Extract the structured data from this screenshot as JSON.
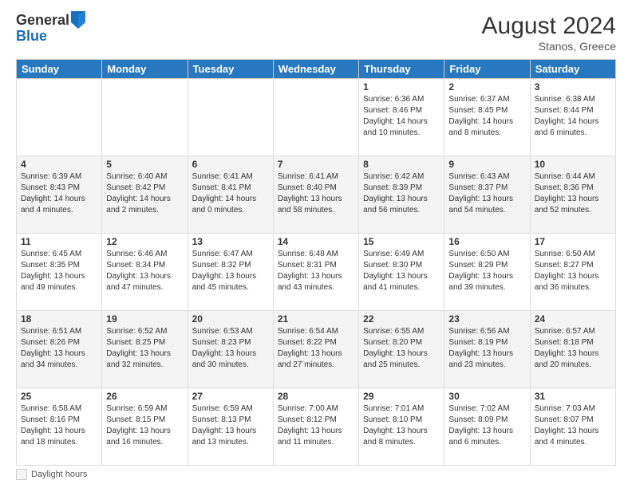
{
  "logo": {
    "general": "General",
    "blue": "Blue"
  },
  "title": "August 2024",
  "location": "Stanos, Greece",
  "legend": "Daylight hours",
  "days_of_week": [
    "Sunday",
    "Monday",
    "Tuesday",
    "Wednesday",
    "Thursday",
    "Friday",
    "Saturday"
  ],
  "weeks": [
    [
      {
        "day": "",
        "info": ""
      },
      {
        "day": "",
        "info": ""
      },
      {
        "day": "",
        "info": ""
      },
      {
        "day": "",
        "info": ""
      },
      {
        "day": "1",
        "info": "Sunrise: 6:36 AM\nSunset: 8:46 PM\nDaylight: 14 hours\nand 10 minutes."
      },
      {
        "day": "2",
        "info": "Sunrise: 6:37 AM\nSunset: 8:45 PM\nDaylight: 14 hours\nand 8 minutes."
      },
      {
        "day": "3",
        "info": "Sunrise: 6:38 AM\nSunset: 8:44 PM\nDaylight: 14 hours\nand 6 minutes."
      }
    ],
    [
      {
        "day": "4",
        "info": "Sunrise: 6:39 AM\nSunset: 8:43 PM\nDaylight: 14 hours\nand 4 minutes."
      },
      {
        "day": "5",
        "info": "Sunrise: 6:40 AM\nSunset: 8:42 PM\nDaylight: 14 hours\nand 2 minutes."
      },
      {
        "day": "6",
        "info": "Sunrise: 6:41 AM\nSunset: 8:41 PM\nDaylight: 14 hours\nand 0 minutes."
      },
      {
        "day": "7",
        "info": "Sunrise: 6:41 AM\nSunset: 8:40 PM\nDaylight: 13 hours\nand 58 minutes."
      },
      {
        "day": "8",
        "info": "Sunrise: 6:42 AM\nSunset: 8:39 PM\nDaylight: 13 hours\nand 56 minutes."
      },
      {
        "day": "9",
        "info": "Sunrise: 6:43 AM\nSunset: 8:37 PM\nDaylight: 13 hours\nand 54 minutes."
      },
      {
        "day": "10",
        "info": "Sunrise: 6:44 AM\nSunset: 8:36 PM\nDaylight: 13 hours\nand 52 minutes."
      }
    ],
    [
      {
        "day": "11",
        "info": "Sunrise: 6:45 AM\nSunset: 8:35 PM\nDaylight: 13 hours\nand 49 minutes."
      },
      {
        "day": "12",
        "info": "Sunrise: 6:46 AM\nSunset: 8:34 PM\nDaylight: 13 hours\nand 47 minutes."
      },
      {
        "day": "13",
        "info": "Sunrise: 6:47 AM\nSunset: 8:32 PM\nDaylight: 13 hours\nand 45 minutes."
      },
      {
        "day": "14",
        "info": "Sunrise: 6:48 AM\nSunset: 8:31 PM\nDaylight: 13 hours\nand 43 minutes."
      },
      {
        "day": "15",
        "info": "Sunrise: 6:49 AM\nSunset: 8:30 PM\nDaylight: 13 hours\nand 41 minutes."
      },
      {
        "day": "16",
        "info": "Sunrise: 6:50 AM\nSunset: 8:29 PM\nDaylight: 13 hours\nand 39 minutes."
      },
      {
        "day": "17",
        "info": "Sunrise: 6:50 AM\nSunset: 8:27 PM\nDaylight: 13 hours\nand 36 minutes."
      }
    ],
    [
      {
        "day": "18",
        "info": "Sunrise: 6:51 AM\nSunset: 8:26 PM\nDaylight: 13 hours\nand 34 minutes."
      },
      {
        "day": "19",
        "info": "Sunrise: 6:52 AM\nSunset: 8:25 PM\nDaylight: 13 hours\nand 32 minutes."
      },
      {
        "day": "20",
        "info": "Sunrise: 6:53 AM\nSunset: 8:23 PM\nDaylight: 13 hours\nand 30 minutes."
      },
      {
        "day": "21",
        "info": "Sunrise: 6:54 AM\nSunset: 8:22 PM\nDaylight: 13 hours\nand 27 minutes."
      },
      {
        "day": "22",
        "info": "Sunrise: 6:55 AM\nSunset: 8:20 PM\nDaylight: 13 hours\nand 25 minutes."
      },
      {
        "day": "23",
        "info": "Sunrise: 6:56 AM\nSunset: 8:19 PM\nDaylight: 13 hours\nand 23 minutes."
      },
      {
        "day": "24",
        "info": "Sunrise: 6:57 AM\nSunset: 8:18 PM\nDaylight: 13 hours\nand 20 minutes."
      }
    ],
    [
      {
        "day": "25",
        "info": "Sunrise: 6:58 AM\nSunset: 8:16 PM\nDaylight: 13 hours\nand 18 minutes."
      },
      {
        "day": "26",
        "info": "Sunrise: 6:59 AM\nSunset: 8:15 PM\nDaylight: 13 hours\nand 16 minutes."
      },
      {
        "day": "27",
        "info": "Sunrise: 6:59 AM\nSunset: 8:13 PM\nDaylight: 13 hours\nand 13 minutes."
      },
      {
        "day": "28",
        "info": "Sunrise: 7:00 AM\nSunset: 8:12 PM\nDaylight: 13 hours\nand 11 minutes."
      },
      {
        "day": "29",
        "info": "Sunrise: 7:01 AM\nSunset: 8:10 PM\nDaylight: 13 hours\nand 8 minutes."
      },
      {
        "day": "30",
        "info": "Sunrise: 7:02 AM\nSunset: 8:09 PM\nDaylight: 13 hours\nand 6 minutes."
      },
      {
        "day": "31",
        "info": "Sunrise: 7:03 AM\nSunset: 8:07 PM\nDaylight: 13 hours\nand 4 minutes."
      }
    ]
  ]
}
